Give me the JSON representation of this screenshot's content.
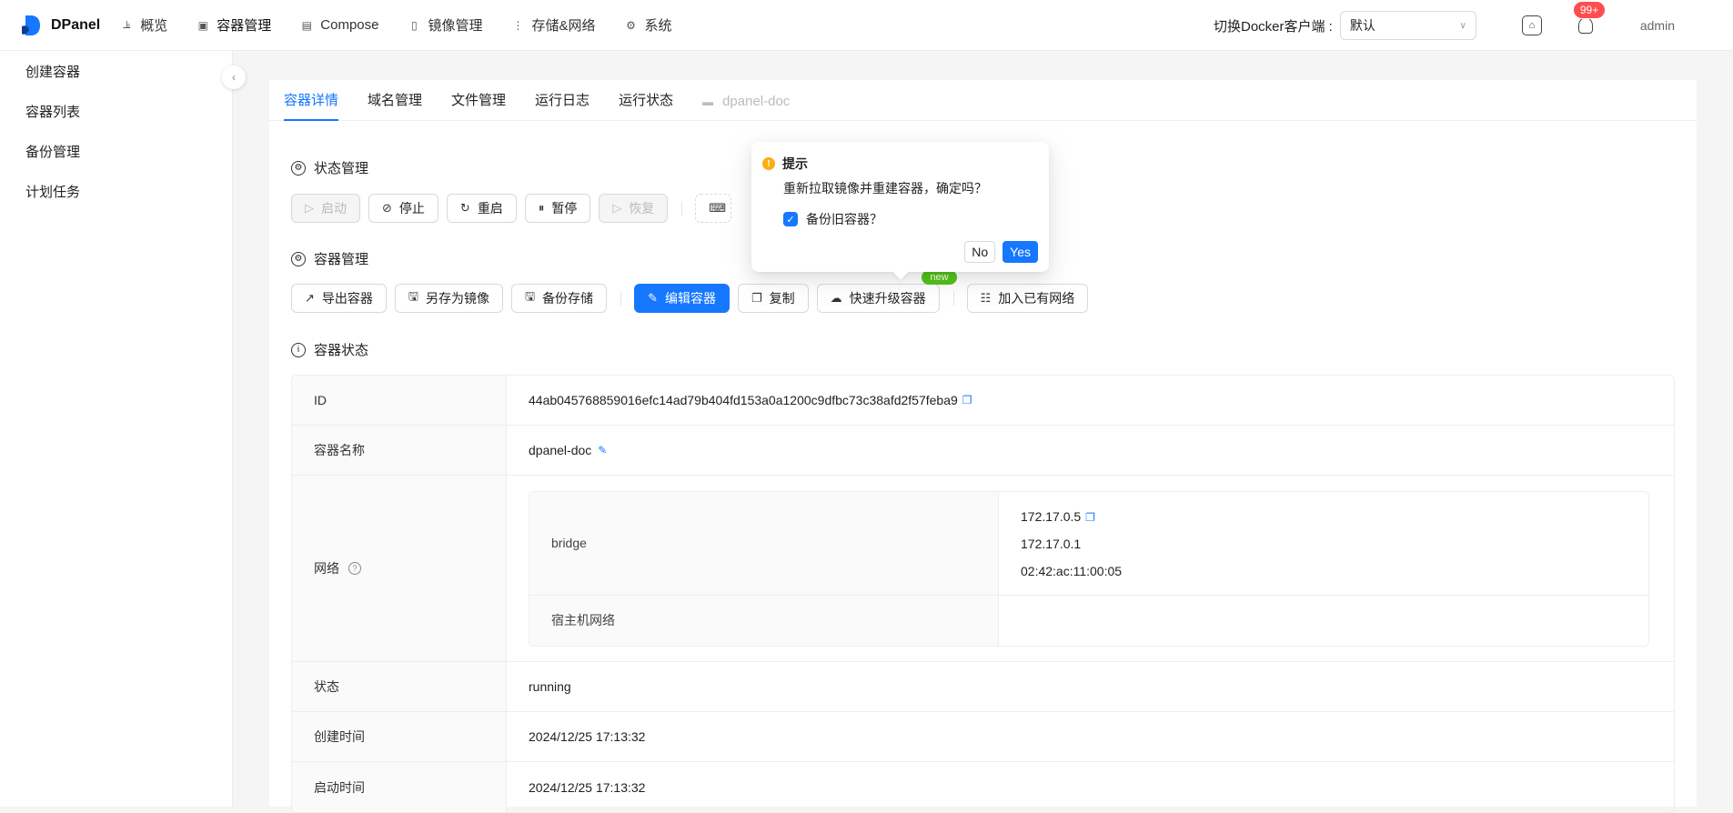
{
  "app": {
    "name": "DPanel"
  },
  "nav": [
    {
      "label": "概览",
      "icon": "chart-icon"
    },
    {
      "label": "容器管理",
      "icon": "container-icon"
    },
    {
      "label": "Compose",
      "icon": "compose-icon"
    },
    {
      "label": "镜像管理",
      "icon": "file-icon"
    },
    {
      "label": "存储&网络",
      "icon": "storage-icon"
    },
    {
      "label": "系统",
      "icon": "gear-icon"
    }
  ],
  "header": {
    "client_label": "切换Docker客户端 :",
    "client_value": "默认",
    "notification_count": "99+",
    "user": "admin"
  },
  "sidebar": {
    "items": [
      {
        "label": "创建容器"
      },
      {
        "label": "容器列表"
      },
      {
        "label": "备份管理"
      },
      {
        "label": "计划任务"
      }
    ]
  },
  "tabs": [
    {
      "label": "容器详情"
    },
    {
      "label": "域名管理"
    },
    {
      "label": "文件管理"
    },
    {
      "label": "运行日志"
    },
    {
      "label": "运行状态"
    },
    {
      "label": "dpanel-doc"
    }
  ],
  "status_section": {
    "title": "状态管理",
    "buttons": {
      "start": "启动",
      "stop": "停止",
      "restart": "重启",
      "pause": "暂停",
      "resume": "恢复"
    }
  },
  "container_section": {
    "title": "容器管理",
    "buttons": {
      "export": "导出容器",
      "save_image": "另存为镜像",
      "backup": "备份存储",
      "edit": "编辑容器",
      "copy": "复制",
      "upgrade": "快速升级容器",
      "upgrade_tag": "new",
      "join_network": "加入已有网络"
    }
  },
  "state_section": {
    "title": "容器状态"
  },
  "details": {
    "id_label": "ID",
    "id_value": "44ab045768859016efc14ad79b404fd153a0a1200c9dfbc73c38afd2f57feba9",
    "name_label": "容器名称",
    "name_value": "dpanel-doc",
    "network_label": "网络",
    "networks": {
      "bridge_label": "bridge",
      "ip": "172.17.0.5",
      "gateway": "172.17.0.1",
      "mac": "02:42:ac:11:00:05",
      "host_label": "宿主机网络"
    },
    "status_label": "状态",
    "status_value": "running",
    "created_label": "创建时间",
    "created_value": "2024/12/25 17:13:32",
    "started_label": "启动时间",
    "started_value": "2024/12/25 17:13:32"
  },
  "popconfirm": {
    "title": "提示",
    "description": "重新拉取镜像并重建容器，确定吗？",
    "checkbox_label": "备份旧容器？",
    "checkbox_checked": true,
    "no": "No",
    "yes": "Yes"
  },
  "colors": {
    "primary": "#1677ff",
    "warning": "#faad14",
    "badge": "#ff4d4f",
    "tag": "#52c41a"
  }
}
